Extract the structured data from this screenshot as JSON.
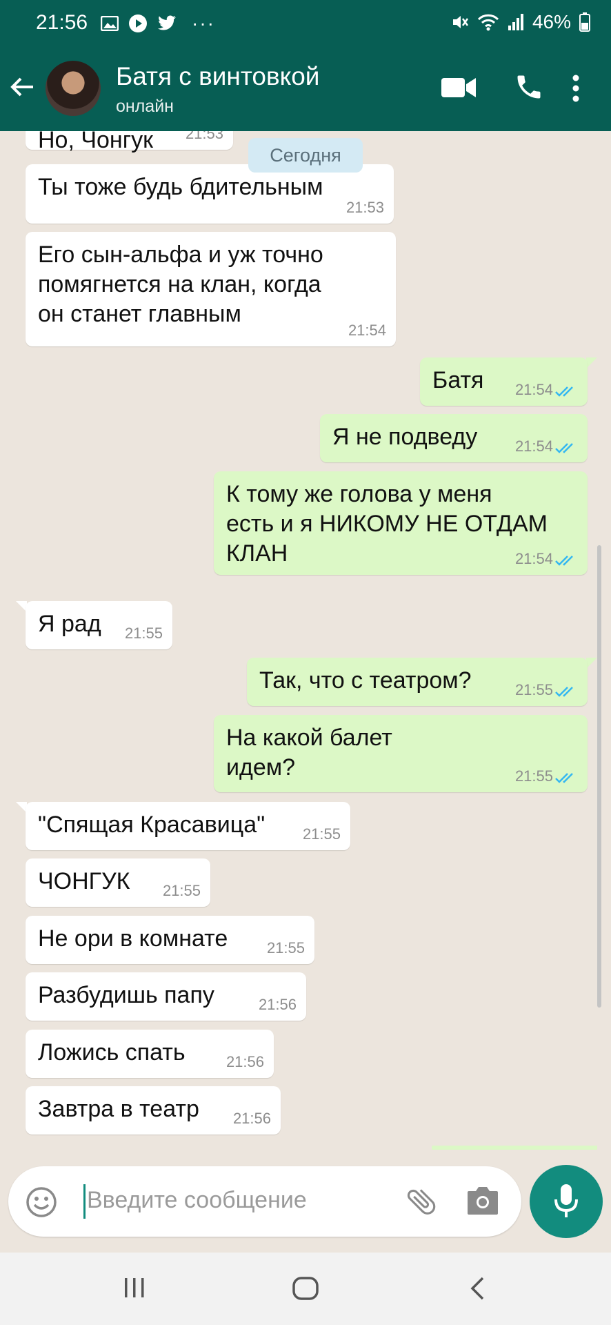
{
  "status_bar": {
    "time": "21:56",
    "battery": "46%"
  },
  "header": {
    "contact_name": "Батя с винтовкой",
    "status": "онлайн"
  },
  "chat": {
    "date_chip": "Сегодня",
    "messages": [
      {
        "dir": "in",
        "text": "Но, Чонгук",
        "time": "21:53"
      },
      {
        "dir": "in",
        "text": "Ты тоже будь бдительным",
        "time": "21:53"
      },
      {
        "dir": "in",
        "text": "Его сын-альфа и уж точно\nпомягнется на клан, когда\nон станет главным",
        "time": "21:54"
      },
      {
        "dir": "out",
        "text": "Батя",
        "time": "21:54"
      },
      {
        "dir": "out",
        "text": "Я не подведу",
        "time": "21:54"
      },
      {
        "dir": "out",
        "text": "К тому же голова у меня\nесть и я НИКОМУ НЕ ОТДАМ\nКЛАН",
        "time": "21:54"
      },
      {
        "dir": "in",
        "text": "Я рад",
        "time": "21:55"
      },
      {
        "dir": "out",
        "text": "Так, что с театром?",
        "time": "21:55"
      },
      {
        "dir": "out",
        "text": "На какой балет\nидем?",
        "time": "21:55"
      },
      {
        "dir": "in",
        "text": "\"Спящая Красавица\"",
        "time": "21:55"
      },
      {
        "dir": "in",
        "text": "ЧОНГУК",
        "time": "21:55"
      },
      {
        "dir": "in",
        "text": "Не ори в комнате",
        "time": "21:55"
      },
      {
        "dir": "in",
        "text": "Разбудишь папу",
        "time": "21:56"
      },
      {
        "dir": "in",
        "text": "Ложись спать",
        "time": "21:56"
      },
      {
        "dir": "in",
        "text": "Завтра в театр",
        "time": "21:56"
      }
    ]
  },
  "composer": {
    "placeholder": "Введите сообщение"
  },
  "colors": {
    "header": "#075e54",
    "accent": "#128c7e",
    "outgoing": "#dcf8c6",
    "incoming": "#ffffff",
    "read_ticks": "#34b7f1",
    "chat_bg": "#ece5dd"
  },
  "icons": [
    "back-arrow-icon",
    "video-call-icon",
    "phone-icon",
    "more-icon",
    "emoji-icon",
    "attach-icon",
    "camera-icon",
    "mic-icon",
    "recents-icon",
    "home-icon",
    "nav-back-icon"
  ]
}
